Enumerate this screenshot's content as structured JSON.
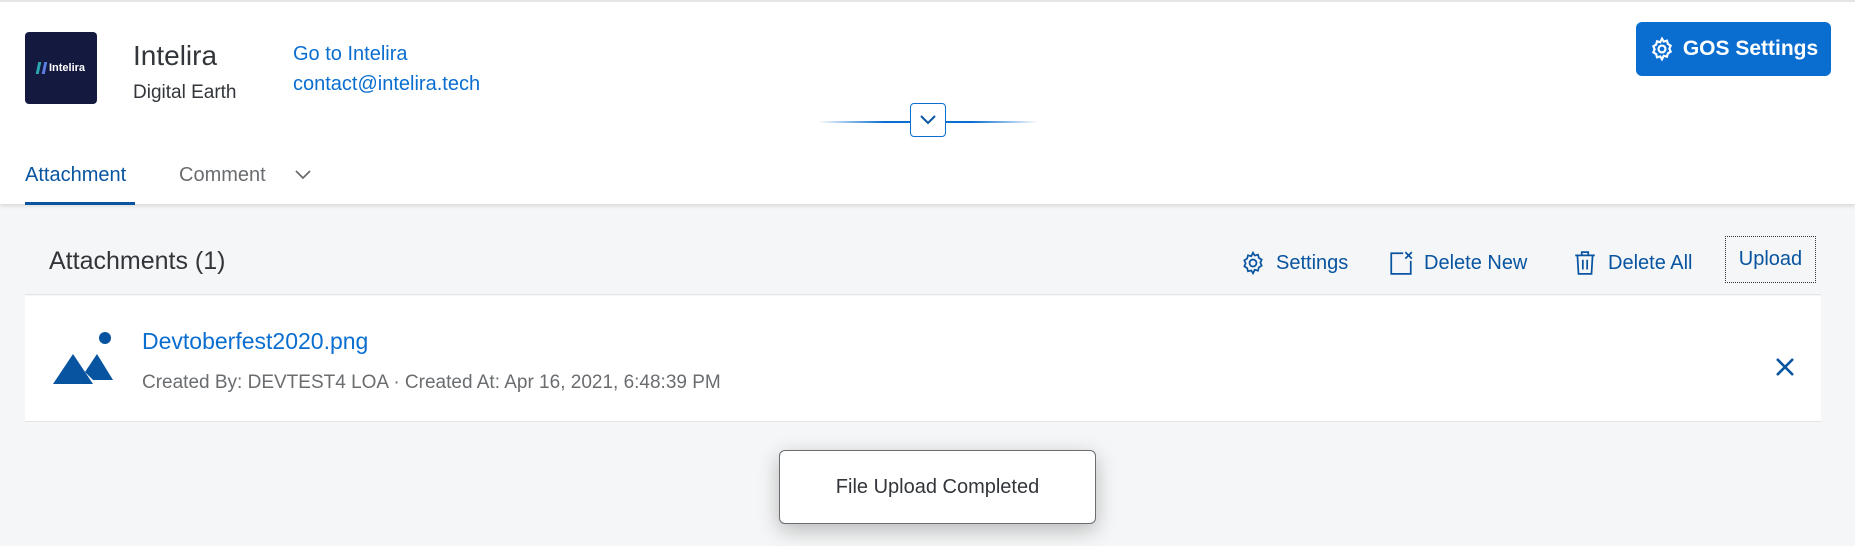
{
  "header": {
    "logo_text": "Intelira",
    "company_name": "Intelira",
    "company_subtitle": "Digital Earth",
    "links": {
      "website": "Go to Intelira",
      "email": "contact@intelira.tech"
    },
    "gos_settings_label": "GOS Settings",
    "collapse_icon": "chevron-down-icon"
  },
  "tabs": [
    {
      "label": "Attachment",
      "selected": true
    },
    {
      "label": "Comment",
      "selected": false
    }
  ],
  "attachments": {
    "title": "Attachments (1)",
    "toolbar": {
      "settings_label": "Settings",
      "delete_new_label": "Delete New",
      "delete_all_label": "Delete All",
      "upload_label": "Upload"
    },
    "items": [
      {
        "file_name": "Devtoberfest2020.png",
        "meta": "Created By: DEVTEST4 LOA · Created At: Apr 16, 2021, 6:48:39 PM",
        "icon": "image-icon"
      }
    ]
  },
  "toast": {
    "message": "File Upload Completed"
  },
  "colors": {
    "accent": "#0a6ed1",
    "link": "#0854a0",
    "background": "#f5f6f7",
    "logo_bg": "#141a3f"
  }
}
